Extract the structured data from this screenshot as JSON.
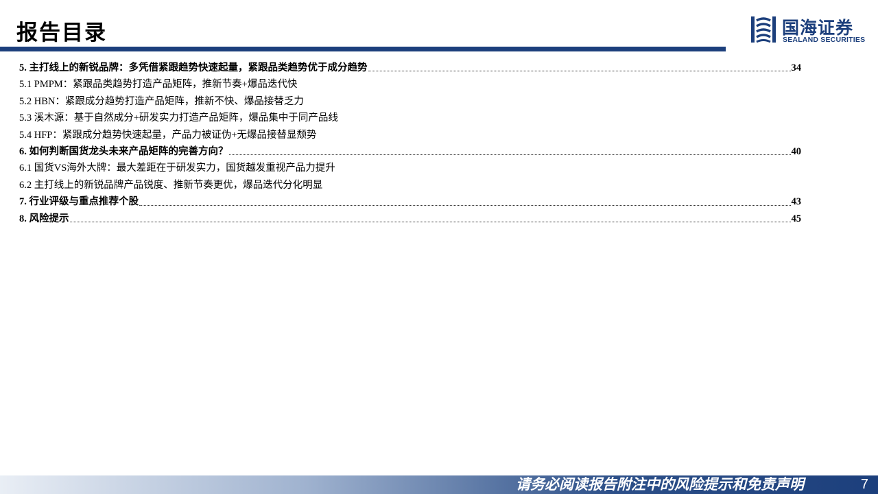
{
  "header": {
    "title": "报告目录",
    "logo_cn": "国海证券",
    "logo_en": "SEALAND SECURITIES",
    "accent_color": "#1c3f7c"
  },
  "toc": [
    {
      "level": 1,
      "label": "5. 主打线上的新锐品牌：多凭借紧跟趋势快速起量，紧跟品类趋势优于成分趋势",
      "page": "34"
    },
    {
      "level": 2,
      "label": "5.1 PMPM：紧跟品类趋势打造产品矩阵，推新节奏+爆品迭代快",
      "page": ""
    },
    {
      "level": 2,
      "label": "5.2 HBN：紧跟成分趋势打造产品矩阵，推新不快、爆品接替乏力",
      "page": ""
    },
    {
      "level": 2,
      "label": "5.3 溪木源：基于自然成分+研发实力打造产品矩阵，爆品集中于同产品线",
      "page": ""
    },
    {
      "level": 2,
      "label": "5.4 HFP：紧跟成分趋势快速起量，产品力被证伪+无爆品接替显颓势",
      "page": ""
    },
    {
      "level": 1,
      "label": "6. 如何判断国货龙头未来产品矩阵的完善方向？",
      "page": "40"
    },
    {
      "level": 2,
      "label": "6.1 国货VS海外大牌：最大差距在于研发实力，国货越发重视产品力提升",
      "page": ""
    },
    {
      "level": 2,
      "label": "6.2 主打线上的新锐品牌产品锐度、推新节奏更优，爆品迭代分化明显",
      "page": ""
    },
    {
      "level": 1,
      "label": "7. 行业评级与重点推荐个股",
      "page": "43"
    },
    {
      "level": 1,
      "label": "8. 风险提示",
      "page": "45"
    }
  ],
  "footer": {
    "disclaimer": "请务必阅读报告附注中的风险提示和免责声明",
    "page_number": "7"
  }
}
